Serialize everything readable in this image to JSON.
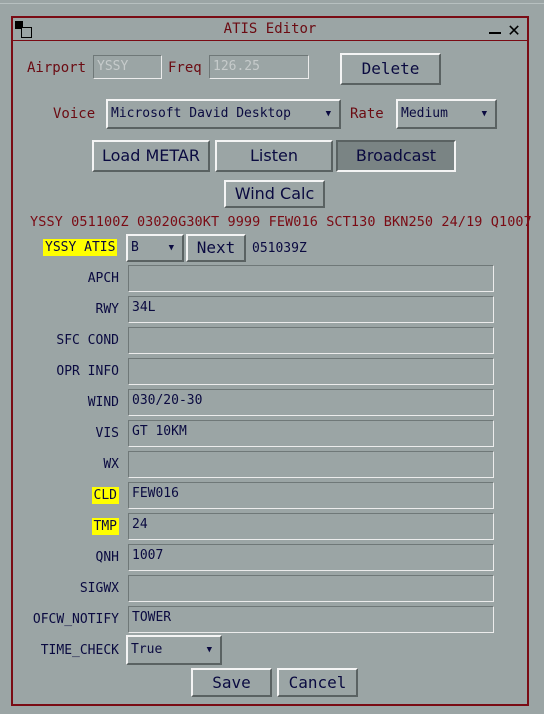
{
  "window": {
    "title": "ATIS Editor"
  },
  "top": {
    "airport_label": "Airport",
    "airport_value": "YSSY",
    "freq_label": "Freq",
    "freq_value": "126.25",
    "delete_label": "Delete"
  },
  "voice": {
    "label": "Voice",
    "selected": "Microsoft David Desktop",
    "rate_label": "Rate",
    "rate_selected": "Medium"
  },
  "actions": {
    "load_metar": "Load METAR",
    "listen": "Listen",
    "broadcast": "Broadcast",
    "wind_calc": "Wind Calc"
  },
  "metar": "YSSY 051100Z 03020G30KT 9999 FEW016 SCT130 BKN250 24/19 Q1007",
  "atis": {
    "label": "YSSY ATIS",
    "letter": "B",
    "next_label": "Next",
    "time": "051039Z"
  },
  "fields": [
    {
      "label": "APCH",
      "value": "",
      "highlight": false
    },
    {
      "label": "RWY",
      "value": "34L",
      "highlight": false
    },
    {
      "label": "SFC COND",
      "value": "",
      "highlight": false
    },
    {
      "label": "OPR INFO",
      "value": "",
      "highlight": false
    },
    {
      "label": "WIND",
      "value": "030/20-30",
      "highlight": false
    },
    {
      "label": "VIS",
      "value": "GT 10KM",
      "highlight": false
    },
    {
      "label": "WX",
      "value": "",
      "highlight": false
    },
    {
      "label": "CLD",
      "value": "FEW016",
      "highlight": true
    },
    {
      "label": "TMP",
      "value": "24",
      "highlight": true
    },
    {
      "label": "QNH",
      "value": "1007",
      "highlight": false
    },
    {
      "label": "SIGWX",
      "value": "",
      "highlight": false
    },
    {
      "label": "OFCW_NOTIFY",
      "value": "TOWER",
      "highlight": false
    }
  ],
  "time_check": {
    "label": "TIME_CHECK",
    "selected": "True"
  },
  "footer": {
    "save": "Save",
    "cancel": "Cancel"
  },
  "colors": {
    "background": "#9ba5a5",
    "accent": "#7a0b14",
    "highlight": "#ffff00",
    "text": "#0a0a40"
  }
}
